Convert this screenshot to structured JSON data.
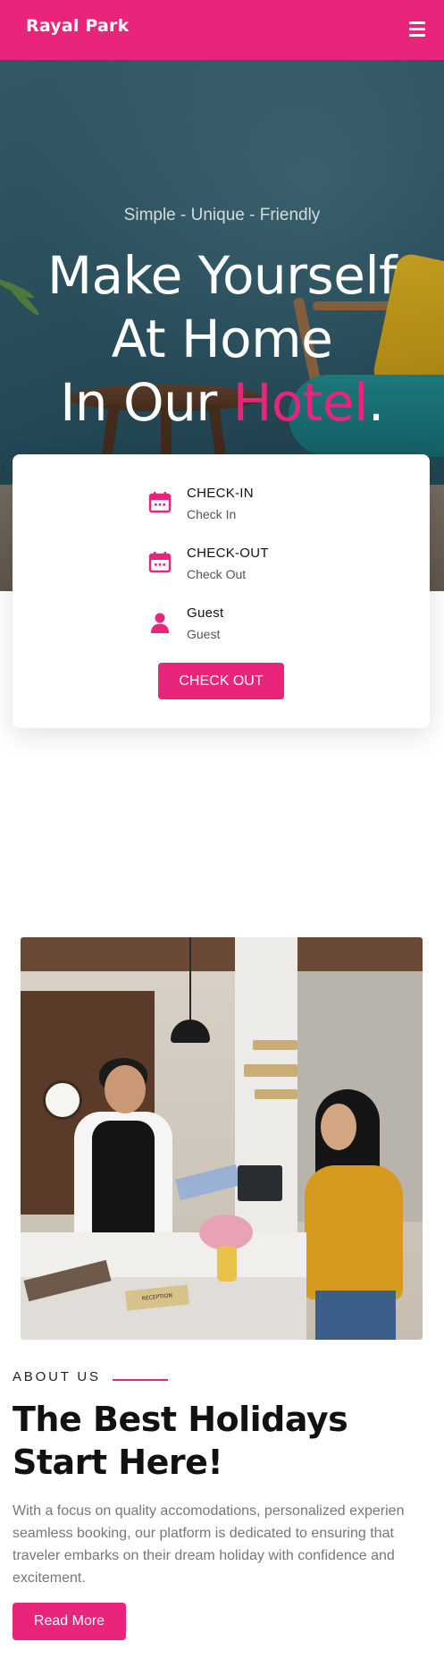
{
  "header": {
    "brand": "Rayal Park",
    "menu_icon": "hamburger-menu-icon"
  },
  "hero": {
    "subtitle": "Simple - Unique - Friendly",
    "title_line1": "Make Yourself",
    "title_line2": "At Home",
    "title_line3_prefix": "In Our ",
    "title_line3_accent": "Hotel",
    "title_line3_suffix": "."
  },
  "booking": {
    "fields": [
      {
        "label": "CHECK-IN",
        "value": "Check In",
        "icon": "calendar-icon"
      },
      {
        "label": "CHECK-OUT",
        "value": "Check Out",
        "icon": "calendar-icon"
      },
      {
        "label": "Guest",
        "value": "Guest",
        "icon": "user-icon"
      }
    ],
    "button_label": "CHECK OUT"
  },
  "about": {
    "image_caption": "RECEPTION",
    "kicker": "ABOUT US",
    "title": "The Best Holidays Start Here!",
    "text": "With a focus on quality accomodations, personalized experien seamless booking, our platform is dedicated to ensuring that traveler embarks on their dream holiday with confidence and excitement.",
    "button_label": "Read More"
  },
  "colors": {
    "brand": "#e8257a",
    "text_dark": "#111111",
    "text_muted": "#777777"
  }
}
